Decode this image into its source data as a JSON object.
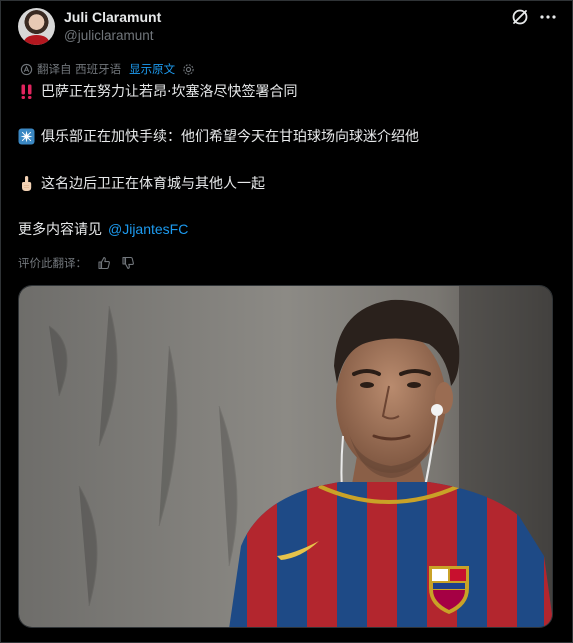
{
  "author": {
    "display_name": "Juli Claramunt",
    "handle": "@juliclaramunt"
  },
  "header_icons": [
    "grok-icon",
    "more-icon"
  ],
  "translation": {
    "from_label": "翻译自 西班牙语",
    "show_original": "显示原文"
  },
  "post": {
    "line1": "巴萨正在努力让若昂·坎塞洛尽快签署合同",
    "line2": "俱乐部正在加快手续：他们希望今天在甘珀球场向球迷介绍他",
    "line3": "这名边后卫正在体育城与其他人一起",
    "line4_prefix": "更多内容请见",
    "line4_mention": "@JijantesFC"
  },
  "rate": {
    "label": "评价此翻译："
  },
  "media": {
    "alt": "photo"
  },
  "colors": {
    "background": "#000000",
    "text": "#e7e9ea",
    "muted": "#71767b",
    "link": "#1d9bf0",
    "emoji_red": "#e0245e"
  }
}
